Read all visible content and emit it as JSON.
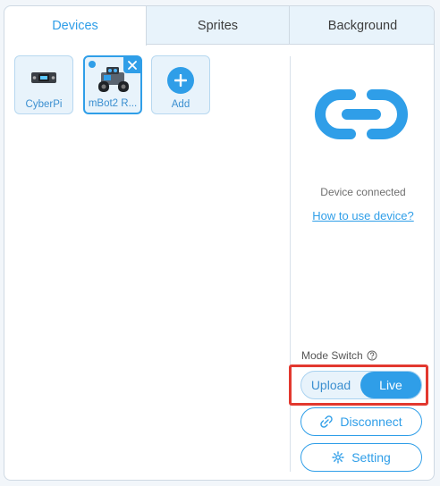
{
  "tabs": [
    {
      "label": "Devices",
      "active": true
    },
    {
      "label": "Sprites"
    },
    {
      "label": "Background"
    }
  ],
  "devices": [
    {
      "label": "CyberPi",
      "icon": "cyberpi-board-icon"
    },
    {
      "label": "mBot2 R...",
      "icon": "mbot2-robot-icon",
      "selected": true
    },
    {
      "label": "Add",
      "icon": "plus-icon"
    }
  ],
  "connection": {
    "icon": "link-icon",
    "status": "Device connected",
    "help_link": "How to use device?"
  },
  "mode_switch": {
    "label": "Mode Switch",
    "options": [
      "Upload",
      "Live"
    ],
    "selected": "Live"
  },
  "buttons": {
    "disconnect": "Disconnect",
    "setting": "Setting"
  },
  "colors": {
    "accent": "#2f9ee8",
    "highlight": "#e2382f"
  }
}
